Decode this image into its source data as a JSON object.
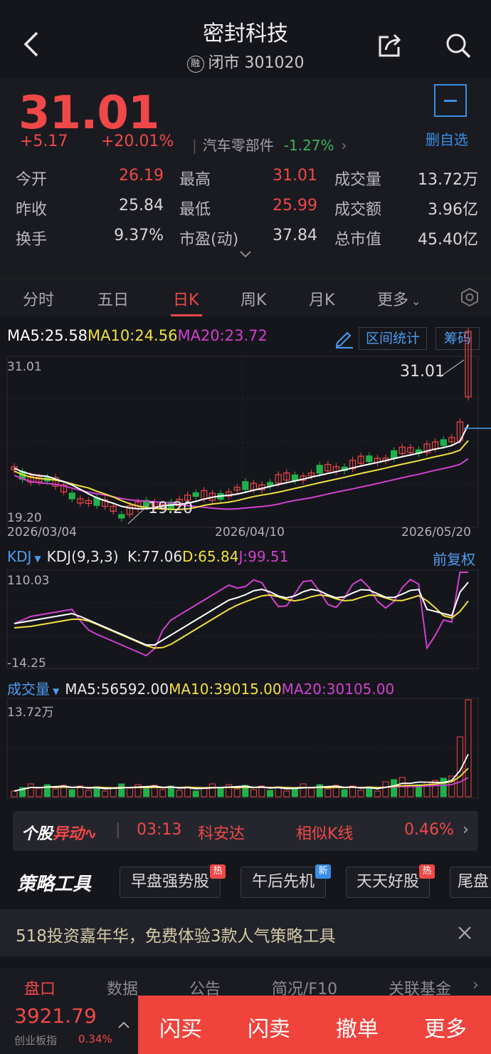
{
  "header": {
    "title": "密封科技",
    "badge": "融",
    "subtitle": "闭市 301020"
  },
  "quote": {
    "price": "31.01",
    "change": "+5.17",
    "change_pct": "+20.01%",
    "sector": "汽车零部件",
    "sector_pct": "-1.27%",
    "watch_label": "删自选",
    "stats": [
      {
        "label": "今开",
        "value": "26.19"
      },
      {
        "label": "最高",
        "value": "31.01"
      },
      {
        "label": "成交量",
        "value": "13.72万"
      },
      {
        "label": "昨收",
        "value": "25.84"
      },
      {
        "label": "最低",
        "value": "25.99"
      },
      {
        "label": "成交额",
        "value": "3.96亿"
      },
      {
        "label": "换手",
        "value": "9.37%"
      },
      {
        "label": "市盈(动)",
        "value": "37.84"
      },
      {
        "label": "总市值",
        "value": "45.40亿"
      }
    ]
  },
  "tabs": [
    "分时",
    "五日",
    "日K",
    "周K",
    "月K",
    "更多"
  ],
  "kline": {
    "ma5": "MA5:25.58",
    "ma10": "MA10:24.56",
    "ma20": "MA20:23.72",
    "range_btn": "区间统计",
    "chip_btn": "筹码",
    "high_label": "31.01",
    "low_label": "19.20",
    "high_marker": "31.01",
    "low_marker": "19.20",
    "dates": [
      "2026/03/04",
      "2026/04/10",
      "2026/05/20"
    ],
    "colors": {
      "up": "#f04848",
      "down": "#20b24a",
      "ma5": "#ffffff",
      "ma10": "#f0e040",
      "ma20": "#d040d0"
    }
  },
  "kdj": {
    "name": "KDJ",
    "params": "KDJ(9,3,3)",
    "k": "K:77.06",
    "d": "D:65.84",
    "j": "J:99.51",
    "adjust": "前复权",
    "top": "110.03",
    "bottom": "-14.25"
  },
  "volume": {
    "name": "成交量",
    "ma5": "MA5:56592.00",
    "ma10": "MA10:39015.00",
    "ma20": "MA20:30105.00",
    "top": "13.72万"
  },
  "alert": {
    "brand_a": "个股",
    "brand_b": "异动",
    "time": "03:13",
    "name": "科安达",
    "kind": "相似K线",
    "pct": "0.46%"
  },
  "strategy": {
    "title": "策略工具",
    "items": [
      {
        "label": "早盘强势股",
        "tag": "热"
      },
      {
        "label": "午后先机",
        "tag": "新"
      },
      {
        "label": "天天好股",
        "tag": "热"
      },
      {
        "label": "尾盘",
        "tag": ""
      }
    ]
  },
  "promo": {
    "text": "518投资嘉年华，免费体验3款人气策略工具"
  },
  "bottom_tabs": [
    "盘口",
    "数据",
    "公告",
    "简况/F10",
    "关联基金"
  ],
  "footer": {
    "index_value": "3921.79",
    "index_name": "创业板指",
    "index_pct": "0.34%",
    "buttons": [
      "闪买",
      "闪卖",
      "撤单",
      "更多"
    ]
  }
}
